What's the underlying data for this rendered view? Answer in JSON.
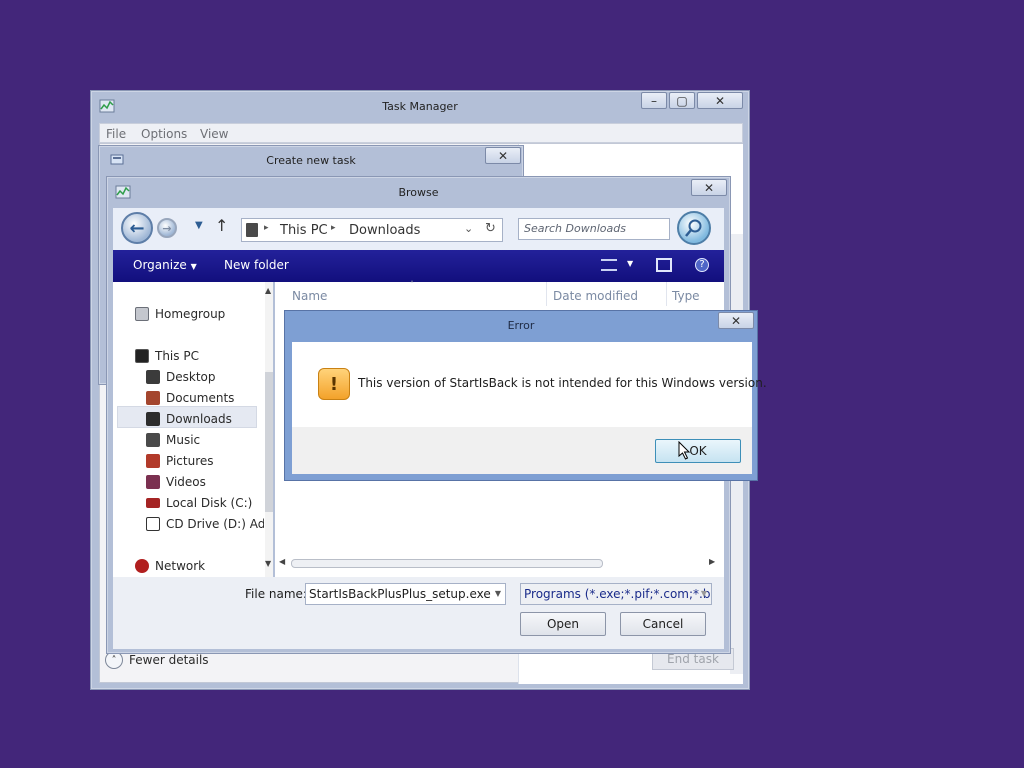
{
  "task_manager": {
    "title": "Task Manager",
    "menu": [
      "File",
      "Options",
      "View"
    ],
    "fewer_details": "Fewer details",
    "end_task": "End task"
  },
  "create_task": {
    "title": "Create new task"
  },
  "browse": {
    "title": "Browse",
    "address": {
      "root": "This PC",
      "folder": "Downloads"
    },
    "search_placeholder": "Search Downloads",
    "toolbar": {
      "organize": "Organize",
      "new_folder": "New folder"
    },
    "nav": {
      "homegroup": "Homegroup",
      "this_pc": "This PC",
      "items": [
        "Desktop",
        "Documents",
        "Downloads",
        "Music",
        "Pictures",
        "Videos",
        "Local Disk (C:)",
        "CD Drive (D:) Adob"
      ],
      "network": "Network"
    },
    "columns": [
      "Name",
      "Date modified",
      "Type"
    ],
    "file_name_label": "File name:",
    "file_name_value": "StartIsBackPlusPlus_setup.exe",
    "file_type_value": "Programs (*.exe;*.pif;*.com;*.ba",
    "open_button": "Open",
    "cancel_button": "Cancel"
  },
  "error_dialog": {
    "title": "Error",
    "message": "This version of StartIsBack is not intended for this Windows version.",
    "ok_button": "OK"
  },
  "colors": {
    "desktop": "#43267a",
    "toolbar": "#1a1890",
    "frame": "#b3bfd7",
    "error_frame": "#7e9fd3"
  }
}
